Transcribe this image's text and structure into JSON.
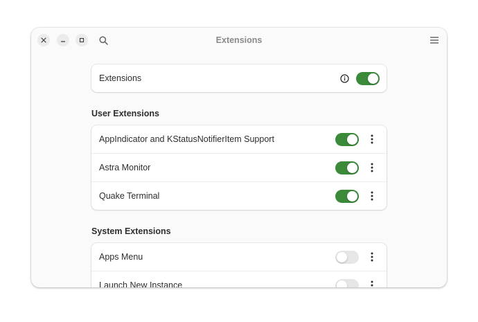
{
  "window": {
    "title": "Extensions"
  },
  "headerbar": {
    "close_icon": "close-icon",
    "minimize_icon": "minimize-icon",
    "maximize_icon": "maximize-icon",
    "search_icon": "search-icon",
    "menu_icon": "hamburger-menu-icon"
  },
  "main_toggle": {
    "label": "Extensions",
    "info_icon": "info-icon",
    "enabled": true
  },
  "user_extensions": {
    "title": "User Extensions",
    "items": [
      {
        "label": "AppIndicator and KStatusNotifierItem Support",
        "enabled": true
      },
      {
        "label": "Astra Monitor",
        "enabled": true
      },
      {
        "label": "Quake Terminal",
        "enabled": true
      }
    ]
  },
  "system_extensions": {
    "title": "System Extensions",
    "items": [
      {
        "label": "Apps Menu",
        "enabled": false
      },
      {
        "label": "Launch New Instance",
        "enabled": false
      }
    ]
  },
  "colors": {
    "accent": "#3a8a3a",
    "switch_off": "#e6e6e6",
    "window_bg": "#fafafa"
  }
}
